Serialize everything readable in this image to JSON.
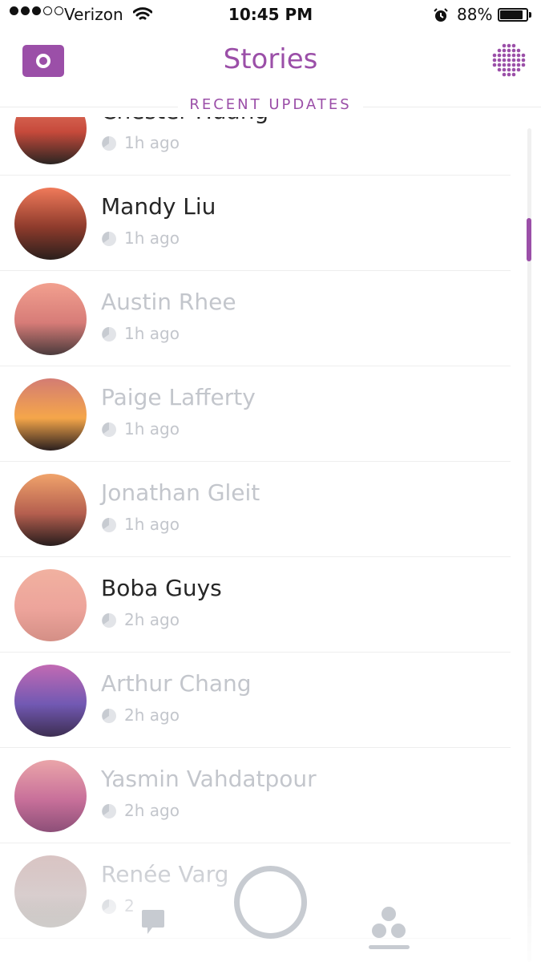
{
  "status_bar": {
    "carrier": "Verizon",
    "time": "10:45 PM",
    "battery": "88%",
    "battery_level": 0.88,
    "signal_bars_filled": 3,
    "signal_bars_total": 5
  },
  "header": {
    "title": "Stories",
    "section_label": "RECENT UPDATES"
  },
  "colors": {
    "brand": "#9b4fa8",
    "viewed_text": "#c3c6cc",
    "unviewed_text": "#262626",
    "muted": "#c7cbd1"
  },
  "stories": [
    {
      "name": "Chester Huang",
      "time": "1h ago",
      "viewed": false,
      "gradient": [
        "#e9806b",
        "#c64a3b",
        "#2b2522"
      ]
    },
    {
      "name": "Mandy Liu",
      "time": "1h ago",
      "viewed": false,
      "gradient": [
        "#f07a5a",
        "#8e3b2c",
        "#2a1f1c"
      ]
    },
    {
      "name": "Austin Rhee",
      "time": "1h ago",
      "viewed": true,
      "gradient": [
        "#f2a08f",
        "#d77c78",
        "#4b3b3c"
      ]
    },
    {
      "name": "Paige Lafferty",
      "time": "1h ago",
      "viewed": true,
      "gradient": [
        "#d37c73",
        "#f5a64a",
        "#2b1f1e"
      ]
    },
    {
      "name": "Jonathan Gleit",
      "time": "1h ago",
      "viewed": true,
      "gradient": [
        "#f0a36b",
        "#b55f4f",
        "#281d1d"
      ]
    },
    {
      "name": "Boba Guys",
      "time": "2h ago",
      "viewed": false,
      "gradient": [
        "#f1b1a0",
        "#eda49b",
        "#d48f86"
      ]
    },
    {
      "name": "Arthur Chang",
      "time": "2h ago",
      "viewed": true,
      "gradient": [
        "#c26ab3",
        "#7259b3",
        "#3d2e52"
      ]
    },
    {
      "name": "Yasmin Vahdatpour",
      "time": "2h ago",
      "viewed": true,
      "gradient": [
        "#eaa5a9",
        "#c8709a",
        "#8d4f78"
      ]
    },
    {
      "name": "Renée Varg",
      "time": "2",
      "viewed": true,
      "gradient": [
        "#d8c2c1",
        "#c5b4b4",
        "#8b857f"
      ]
    }
  ],
  "icons": {
    "camera": "camera-icon",
    "discover": "discover-grid-icon",
    "wifi": "wifi-icon",
    "alarm": "alarm-icon",
    "timer": "timer-icon",
    "chat": "chat-icon",
    "stories": "stories-icon"
  }
}
